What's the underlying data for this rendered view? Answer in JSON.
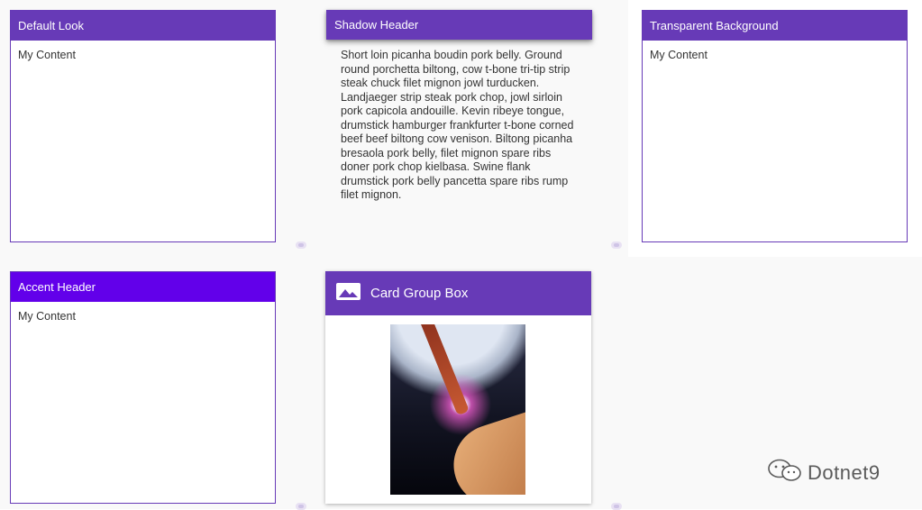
{
  "cards": {
    "default_look": {
      "header": "Default Look",
      "content": "My Content"
    },
    "shadow_header": {
      "header": "Shadow Header",
      "content": "Short loin picanha boudin pork belly. Ground round porchetta biltong, cow t-bone tri-tip strip steak chuck filet mignon jowl turducken. Landjaeger strip steak pork chop, jowl sirloin pork capicola andouille. Kevin ribeye tongue, drumstick hamburger frankfurter t-bone corned beef beef biltong cow venison. Biltong picanha bresaola pork belly, filet mignon spare ribs doner pork chop kielbasa. Swine flank drumstick pork belly pancetta spare ribs rump filet mignon."
    },
    "transparent_background": {
      "header": "Transparent Background",
      "content": "My Content"
    },
    "accent_header": {
      "header": "Accent Header",
      "content": "My Content"
    },
    "card_group_box": {
      "header": "Card Group Box",
      "icon": "image-icon"
    }
  },
  "watermark": {
    "text": "Dotnet9",
    "icon": "wechat-icon"
  },
  "colors": {
    "primary": "#673ab7",
    "accent": "#6200ea",
    "background": "#f9f9f9"
  }
}
